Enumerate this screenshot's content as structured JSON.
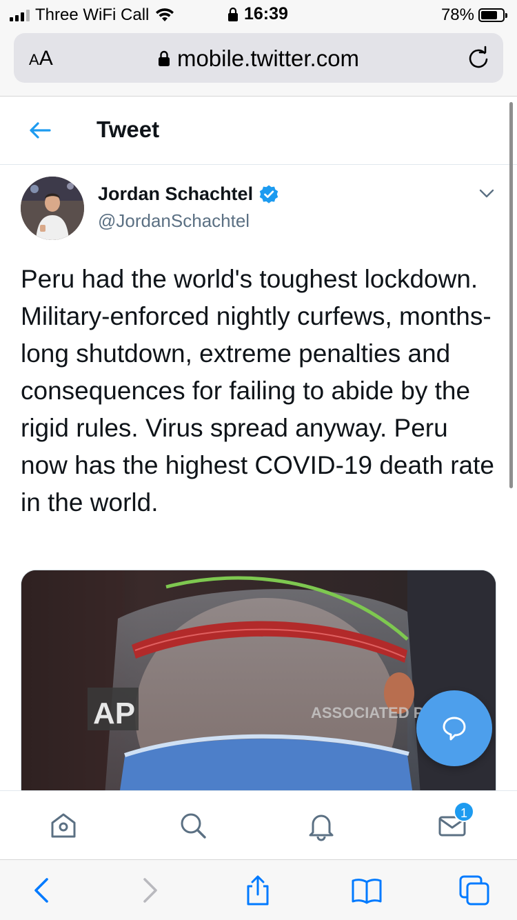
{
  "status_bar": {
    "carrier": "Three WiFi Call",
    "time": "16:39",
    "battery_percent": "78%",
    "battery_level": 0.78
  },
  "browser": {
    "text_size_label_small": "A",
    "text_size_label_large": "A",
    "url": "mobile.twitter.com"
  },
  "header": {
    "title": "Tweet"
  },
  "tweet": {
    "author_name": "Jordan Schachtel",
    "author_handle": "@JordanSchachtel",
    "text": "Peru had the world's toughest lockdown. Military-enforced nightly curfews, months-long shutdown, extreme penalties and consequences for failing to abide by the rigid rules. Virus spread anyway. Peru now has the highest COVID-19 death rate in the world.",
    "media_watermark_left": "AP",
    "media_watermark_right": "ASSOCIATED PRESS"
  },
  "nav": {
    "items": [
      "home-icon",
      "search-icon",
      "notifications-icon",
      "messages-icon"
    ],
    "messages_badge": "1"
  },
  "colors": {
    "accent": "#1d9bf0",
    "fab": "#4d9fec",
    "safari_blue": "#007aff"
  }
}
